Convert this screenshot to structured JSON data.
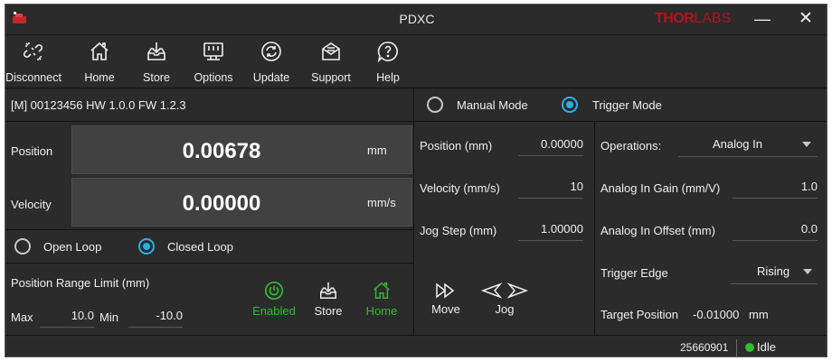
{
  "window": {
    "title": "PDXC",
    "brand_bold": "THOR",
    "brand_rest": "LABS",
    "minimize_glyph": "—",
    "close_glyph": "✕"
  },
  "toolbar": {
    "items": [
      {
        "label": "Disconnect",
        "icon": "unlink-icon"
      },
      {
        "label": "Home",
        "icon": "home-icon"
      },
      {
        "label": "Store",
        "icon": "store-icon"
      },
      {
        "label": "Options",
        "icon": "options-icon"
      },
      {
        "label": "Update",
        "icon": "refresh-icon"
      },
      {
        "label": "Support",
        "icon": "mail-icon"
      },
      {
        "label": "Help",
        "icon": "help-icon"
      }
    ]
  },
  "device": {
    "info": "[M] 00123456 HW 1.0.0 FW 1.2.3"
  },
  "readouts": {
    "position": {
      "label": "Position",
      "value": "0.00678",
      "unit": "mm"
    },
    "velocity": {
      "label": "Velocity",
      "value": "0.00000",
      "unit": "mm/s"
    }
  },
  "loop": {
    "open_label": "Open Loop",
    "closed_label": "Closed Loop",
    "selected": "Closed Loop"
  },
  "range_limit": {
    "title": "Position Range Limit (mm)",
    "max_label": "Max",
    "max_value": "10.0",
    "min_label": "Min",
    "min_value": "-10.0",
    "enabled_label": "Enabled",
    "store_label": "Store",
    "home_label": "Home"
  },
  "mode": {
    "manual_label": "Manual Mode",
    "trigger_label": "Trigger Mode",
    "selected": "Trigger Mode"
  },
  "manual": {
    "position_label": "Position (mm)",
    "position_value": "0.00000",
    "velocity_label": "Velocity (mm/s)",
    "velocity_value": "10",
    "jog_step_label": "Jog Step (mm)",
    "jog_step_value": "1.00000",
    "move_label": "Move",
    "jog_label": "Jog"
  },
  "trigger": {
    "operations_label": "Operations:",
    "operations_value": "Analog In",
    "gain_label": "Analog In Gain (mm/V)",
    "gain_value": "1.0",
    "offset_label": "Analog In Offset (mm)",
    "offset_value": "0.0",
    "edge_label": "Trigger Edge",
    "edge_value": "Rising",
    "target_label": "Target Position",
    "target_value": "-0.01000",
    "target_unit": "mm"
  },
  "status": {
    "serial": "25660901",
    "state": "Idle"
  },
  "colors": {
    "background": "#2b2b2b",
    "readout_bg": "#414141",
    "accent": "#2ab0e6",
    "enabled_green": "#2fbf2f",
    "brand_red": "#b3131b"
  }
}
